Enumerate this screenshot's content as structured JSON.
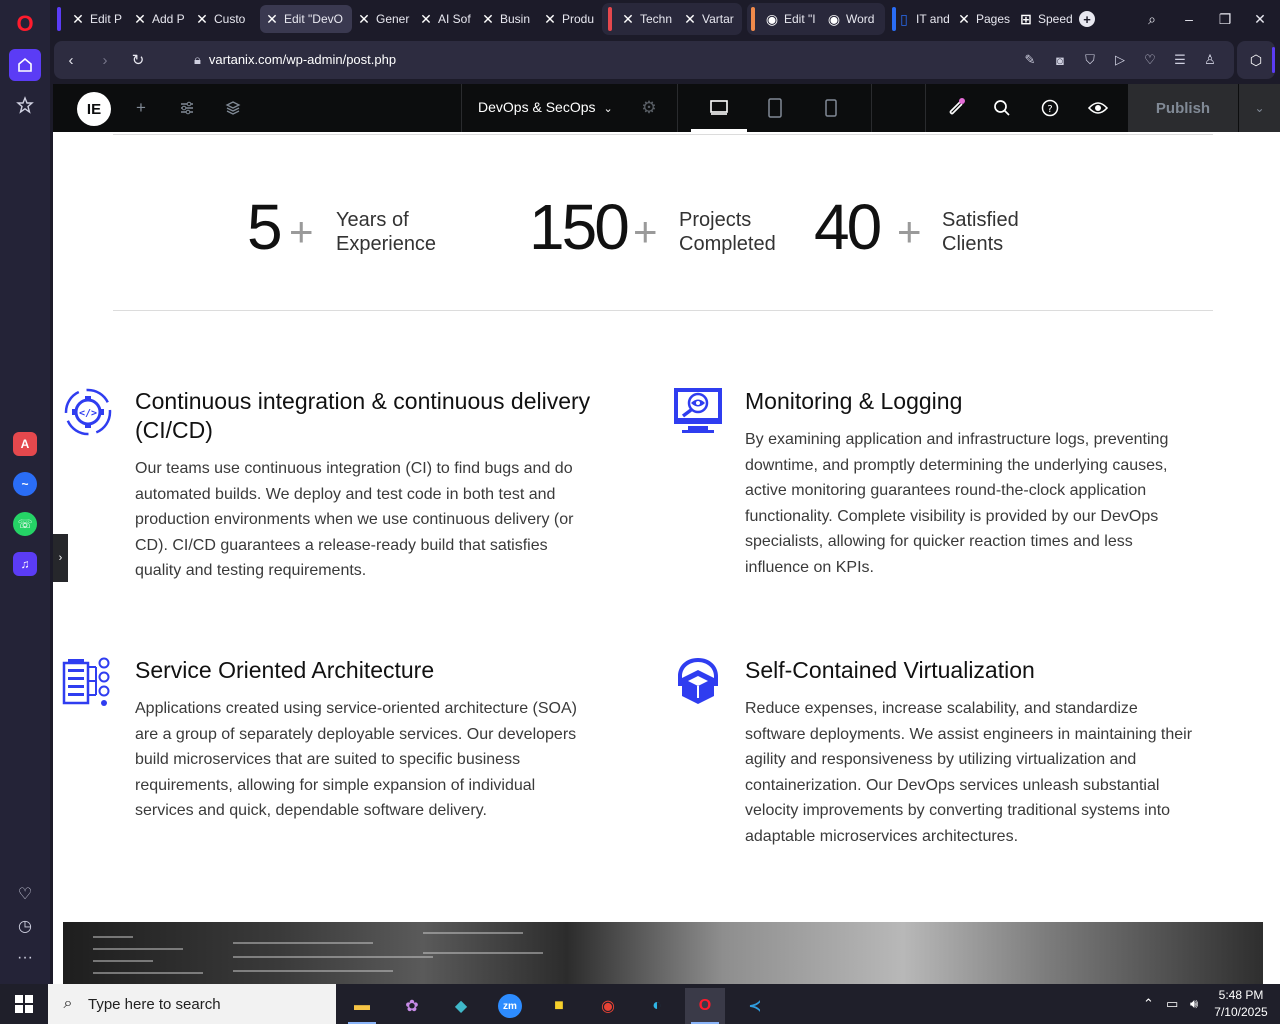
{
  "browser": {
    "tabs": [
      {
        "label": "Edit P",
        "icon": "elementor-icon",
        "active": false
      },
      {
        "label": "Add P",
        "icon": "elementor-icon",
        "active": false
      },
      {
        "label": "Custo",
        "icon": "elementor-icon",
        "active": false
      },
      {
        "label": "Edit \"DevO",
        "icon": "elementor-icon",
        "active": true
      },
      {
        "label": "Gener",
        "icon": "elementor-icon",
        "active": false
      },
      {
        "label": "AI Sof",
        "icon": "elementor-icon",
        "active": false
      },
      {
        "label": "Busin",
        "icon": "elementor-icon",
        "active": false
      },
      {
        "label": "Produ",
        "icon": "elementor-icon",
        "active": false
      },
      {
        "label": "Techn",
        "icon": "elementor-icon",
        "active": false
      },
      {
        "label": "Vartar",
        "icon": "elementor-icon",
        "active": false
      },
      {
        "label": "Edit \"I",
        "icon": "wordpress-icon",
        "active": false
      },
      {
        "label": "Word",
        "icon": "wordpress-icon",
        "active": false
      },
      {
        "label": "IT and",
        "icon": "page-icon",
        "active": false
      },
      {
        "label": "Pages",
        "icon": "elementor-icon",
        "active": false
      },
      {
        "label": "Speed",
        "icon": "grid-icon",
        "active": false
      }
    ],
    "url": "vartanix.com/wp-admin/post.php",
    "accent": "#5b3cf5"
  },
  "editor": {
    "page_title": "DevOps & SecOps",
    "publish_label": "Publish"
  },
  "stats": [
    {
      "number": "5",
      "plus": "+",
      "label_line1": "Years of",
      "label_line2": "Experience"
    },
    {
      "number": "150",
      "plus": "+",
      "label_line1": "Projects",
      "label_line2": "Completed"
    },
    {
      "number": "40",
      "plus": "+",
      "label_line1": "Satisfied",
      "label_line2": "Clients"
    }
  ],
  "services": [
    {
      "icon": "cicd-gear-icon",
      "title": "Continuous integration & continuous delivery (CI/CD)",
      "description": "Our teams use continuous integration (CI) to find bugs and do automated builds. We deploy and test code in both test and production environments when we use continuous delivery (or CD). CI/CD guarantees a release-ready build that satisfies quality and testing requirements."
    },
    {
      "icon": "monitoring-eye-icon",
      "title": "Monitoring & Logging",
      "description": "By examining application and infrastructure logs, preventing downtime, and promptly determining the underlying causes, active monitoring guarantees round-the-clock application functionality. Complete visibility is provided by our DevOps specialists, allowing for quicker reaction times and less influence on KPIs."
    },
    {
      "icon": "soa-building-icon",
      "title": "Service Oriented Architecture",
      "description": "Applications created using service-oriented architecture (SOA) are a group of separately deployable services. Our developers build microservices that are suited to specific business requirements, allowing for simple expansion of individual services and quick, dependable software delivery."
    },
    {
      "icon": "virtualization-cube-icon",
      "title": "Self-Contained Virtualization",
      "description": "Reduce expenses, increase scalability, and standardize software deployments. We assist engineers in maintaining their agility and responsiveness by utilizing virtualization and containerization. Our DevOps services unleash substantial velocity improvements by converting traditional systems into adaptable microservices architectures."
    }
  ],
  "taskbar": {
    "search_placeholder": "Type here to search",
    "time": "5:48 PM",
    "date": "7/10/2025"
  },
  "colors": {
    "icon_blue": "#2f3df0",
    "elementor_bar": "#0c0d0e"
  }
}
